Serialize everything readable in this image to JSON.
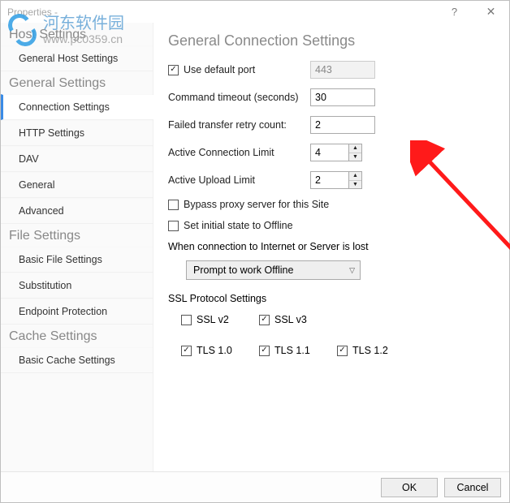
{
  "titlebar": {
    "title": "Properties -"
  },
  "sidebar": {
    "groups": [
      {
        "header": "Host Settings",
        "items": [
          {
            "label": "General Host Settings"
          }
        ]
      },
      {
        "header": "General Settings",
        "items": [
          {
            "label": "Connection Settings",
            "selected": true
          },
          {
            "label": "HTTP Settings"
          },
          {
            "label": "DAV"
          },
          {
            "label": "General"
          },
          {
            "label": "Advanced"
          }
        ]
      },
      {
        "header": "File Settings",
        "items": [
          {
            "label": "Basic File Settings"
          },
          {
            "label": "Substitution"
          },
          {
            "label": "Endpoint Protection"
          }
        ]
      },
      {
        "header": "Cache Settings",
        "items": [
          {
            "label": "Basic Cache Settings"
          }
        ]
      }
    ]
  },
  "main": {
    "heading": "General Connection Settings",
    "use_default_port": {
      "label": "Use default port",
      "checked": true,
      "port": "443"
    },
    "command_timeout": {
      "label": "Command timeout (seconds)",
      "value": "30"
    },
    "retry_count": {
      "label": "Failed transfer retry count:",
      "value": "2"
    },
    "conn_limit": {
      "label": "Active Connection Limit",
      "value": "4"
    },
    "upload_limit": {
      "label": "Active Upload Limit",
      "value": "2"
    },
    "bypass_proxy": {
      "label": "Bypass proxy server for this Site",
      "checked": false
    },
    "initial_offline": {
      "label": "Set initial state to Offline",
      "checked": false
    },
    "when_lost": {
      "label": "When connection to Internet or Server is lost",
      "selected": "Prompt to work Offline"
    },
    "ssl_heading": "SSL Protocol Settings",
    "ssl": {
      "sslv2": {
        "label": "SSL v2",
        "checked": false
      },
      "sslv3": {
        "label": "SSL v3",
        "checked": true
      },
      "tls10": {
        "label": "TLS 1.0",
        "checked": true
      },
      "tls11": {
        "label": "TLS 1.1",
        "checked": true
      },
      "tls12": {
        "label": "TLS 1.2",
        "checked": true
      }
    }
  },
  "footer": {
    "ok": "OK",
    "cancel": "Cancel"
  },
  "watermark": {
    "cn": "河东软件园",
    "url": "www.pc0359.cn"
  }
}
